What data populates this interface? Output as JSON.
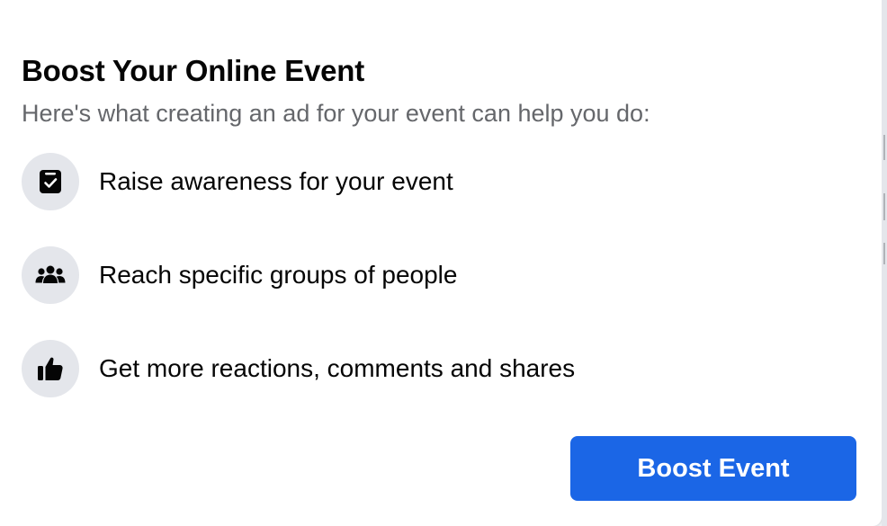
{
  "dialog": {
    "title": "Boost Your Online Event",
    "subtitle": "Here's what creating an ad for your event can help you do:"
  },
  "benefits": [
    {
      "icon": "calendar-check-icon",
      "label": "Raise awareness for your event"
    },
    {
      "icon": "people-group-icon",
      "label": "Reach specific groups of people"
    },
    {
      "icon": "thumbs-up-icon",
      "label": "Get more reactions, comments and shares"
    }
  ],
  "actions": {
    "boost_label": "Boost Event"
  },
  "colors": {
    "primary_button": "#1b66e6",
    "icon_background": "#e4e6eb",
    "title_text": "#050505",
    "subtitle_text": "#65676b"
  }
}
